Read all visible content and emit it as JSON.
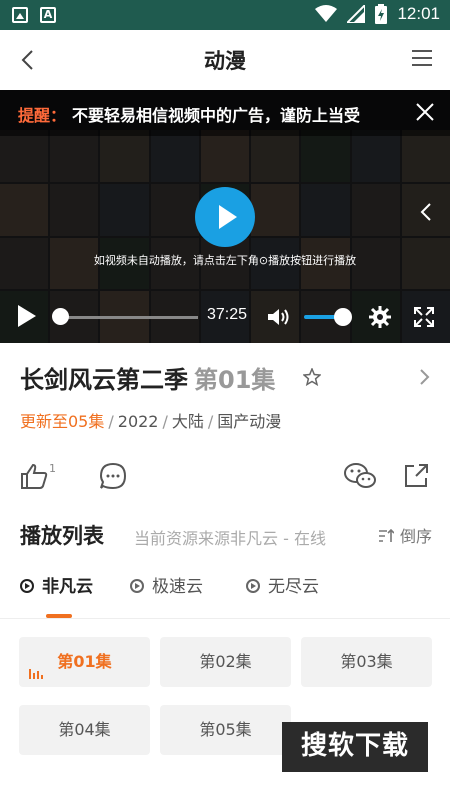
{
  "status_bar": {
    "time": "12:01"
  },
  "app_bar": {
    "title": "动漫"
  },
  "player": {
    "warning_label": "提醒：",
    "warning_text": "不要轻易相信视频中的广告，谨防上当受",
    "hint": "如视频未自动播放，请点击左下角⊙播放按钮进行播放",
    "time": "37:25",
    "seek_progress": 0.0,
    "volume_level": 0.85
  },
  "show": {
    "title": "长剑风云第二季",
    "episode_label": "第01集",
    "updated": "更新至05集",
    "year": "2022",
    "region": "大陆",
    "genre": "国产动漫"
  },
  "actions": {
    "like_count": "1"
  },
  "playlist": {
    "title": "播放列表",
    "source_text": "当前资源来源非凡云 - 在线",
    "sort_label": "倒序",
    "tabs": [
      {
        "label": "非凡云",
        "active": true
      },
      {
        "label": "极速云",
        "active": false
      },
      {
        "label": "无尽云",
        "active": false
      }
    ],
    "episodes": [
      {
        "label": "第01集",
        "active": true
      },
      {
        "label": "第02集",
        "active": false
      },
      {
        "label": "第03集",
        "active": false
      },
      {
        "label": "第04集",
        "active": false
      },
      {
        "label": "第05集",
        "active": false
      }
    ]
  },
  "watermark": "搜软下载",
  "colors": {
    "accent": "#f07020",
    "player_blue": "#1aa0e3",
    "status_bar": "#1f5b4f"
  }
}
